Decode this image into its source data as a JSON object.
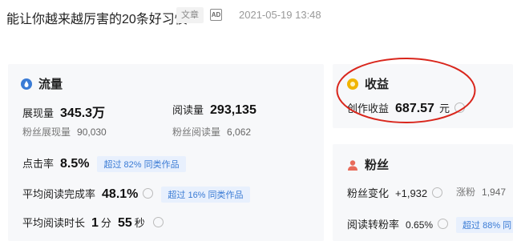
{
  "article": {
    "title": "能让你越来越厉害的20条好习惯",
    "tag": "文章",
    "ad_badge": "AD",
    "datetime": "2021-05-19 13:48"
  },
  "traffic": {
    "heading": "流量",
    "impressions_label": "展现量",
    "impressions_value": "345.3万",
    "reads_label": "阅读量",
    "reads_value": "293,135",
    "fan_impressions_label": "粉丝展现量",
    "fan_impressions_value": "90,030",
    "fan_reads_label": "粉丝阅读量",
    "fan_reads_value": "6,062",
    "ctr_label": "点击率",
    "ctr_value": "8.5%",
    "ctr_badge": "超过 82% 同类作品",
    "completion_label": "平均阅读完成率",
    "completion_value": "48.1%",
    "completion_badge": "超过 16% 同类作品",
    "duration_label": "平均阅读时长",
    "duration_min": "1",
    "duration_min_unit": "分",
    "duration_sec": "55",
    "duration_sec_unit": "秒"
  },
  "income": {
    "heading": "收益",
    "label": "创作收益",
    "value": "687.57",
    "unit": "元"
  },
  "fans": {
    "heading": "粉丝",
    "change_label": "粉丝变化",
    "change_value": "+1,932",
    "gain_label": "涨粉",
    "gain_value": "1,947",
    "conversion_label": "阅读转粉率",
    "conversion_value": "0.65%",
    "conversion_badge": "超过 88% 同"
  },
  "colors": {
    "accent_blue": "#3a7bd5",
    "income_gold": "#f0b400",
    "fans_red": "#e86a5a",
    "annotation_red": "#d9261c"
  }
}
